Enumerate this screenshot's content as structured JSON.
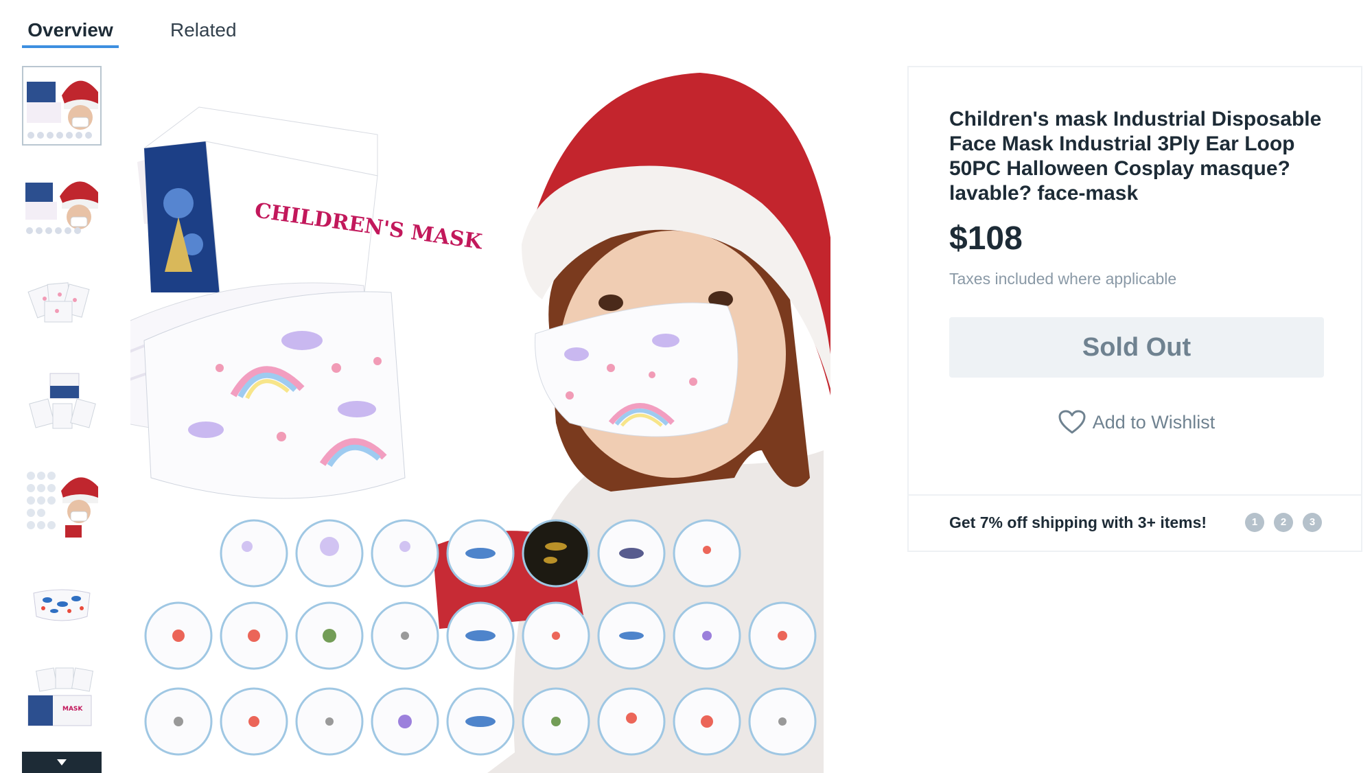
{
  "tabs": {
    "overview": "Overview",
    "related": "Related"
  },
  "thumbnails": [
    {
      "name": "Santa hat child with mask box"
    },
    {
      "name": "Santa hat child with mask box 2"
    },
    {
      "name": "mask packs spread"
    },
    {
      "name": "mask box with packs"
    },
    {
      "name": "mask grid with child"
    },
    {
      "name": "single ocean print mask"
    },
    {
      "name": "children's mask box"
    }
  ],
  "main_image": {
    "box_text": "CHILDREN'S MASK"
  },
  "product": {
    "title": "Children's mask Industrial Disposable Face Mask Industrial 3Ply Ear Loop 50PC Halloween Cosplay masque? lavable? face-mask",
    "price": "$108",
    "tax_note": "Taxes included where applicable",
    "sold_out_label": "Sold Out",
    "wishlist_label": "Add to Wishlist",
    "promo": "Get 7% off shipping with 3+ items!",
    "promo_steps": [
      "1",
      "2",
      "3"
    ]
  },
  "colors": {
    "accent": "#3d8fe0",
    "text": "#1d2b36",
    "muted": "#8a99a6",
    "button_bg": "#eef2f5",
    "button_text": "#6f8290"
  },
  "icons": {
    "wishlist": "heart-icon",
    "more": "chevron-down-icon"
  }
}
